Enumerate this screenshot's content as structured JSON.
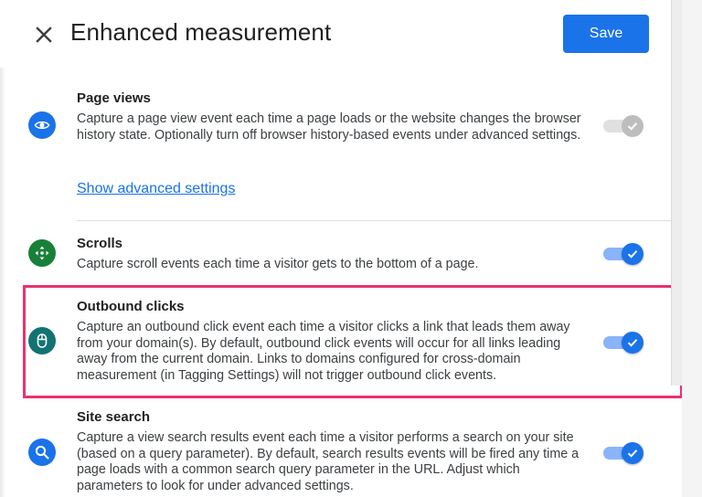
{
  "header": {
    "title": "Enhanced measurement",
    "save_label": "Save"
  },
  "sections": [
    {
      "title": "Page views",
      "description": "Capture a page view event each time a page loads or the website changes the browser history state. Optionally turn off browser history-based events under advanced settings.",
      "link": "Show advanced settings",
      "icon": "eye-icon",
      "toggle": {
        "on": true,
        "disabled": true
      }
    },
    {
      "title": "Scrolls",
      "description": "Capture scroll events each time a visitor gets to the bottom of a page.",
      "icon": "scroll-arrows-icon",
      "toggle": {
        "on": true,
        "disabled": false
      }
    },
    {
      "title": "Outbound clicks",
      "description": "Capture an outbound click event each time a visitor clicks a link that leads them away from your domain(s). By default, outbound click events will occur for all links leading away from the current domain. Links to domains configured for cross-domain measurement (in Tagging Settings) will not trigger outbound click events.",
      "icon": "mouse-icon",
      "toggle": {
        "on": true,
        "disabled": false
      }
    },
    {
      "title": "Site search",
      "description": "Capture a view search results event each time a visitor performs a search on your site (based on a query parameter). By default, search results events will be fired any time a page loads with a common search query parameter in the URL. Adjust which parameters to look for under advanced settings.",
      "icon": "search-icon",
      "toggle": {
        "on": true,
        "disabled": false
      }
    }
  ],
  "colors": {
    "accent": "#1a73e8",
    "highlight_border": "#e8336e",
    "scroll_icon": "#188038",
    "mouse_icon": "#137373"
  }
}
